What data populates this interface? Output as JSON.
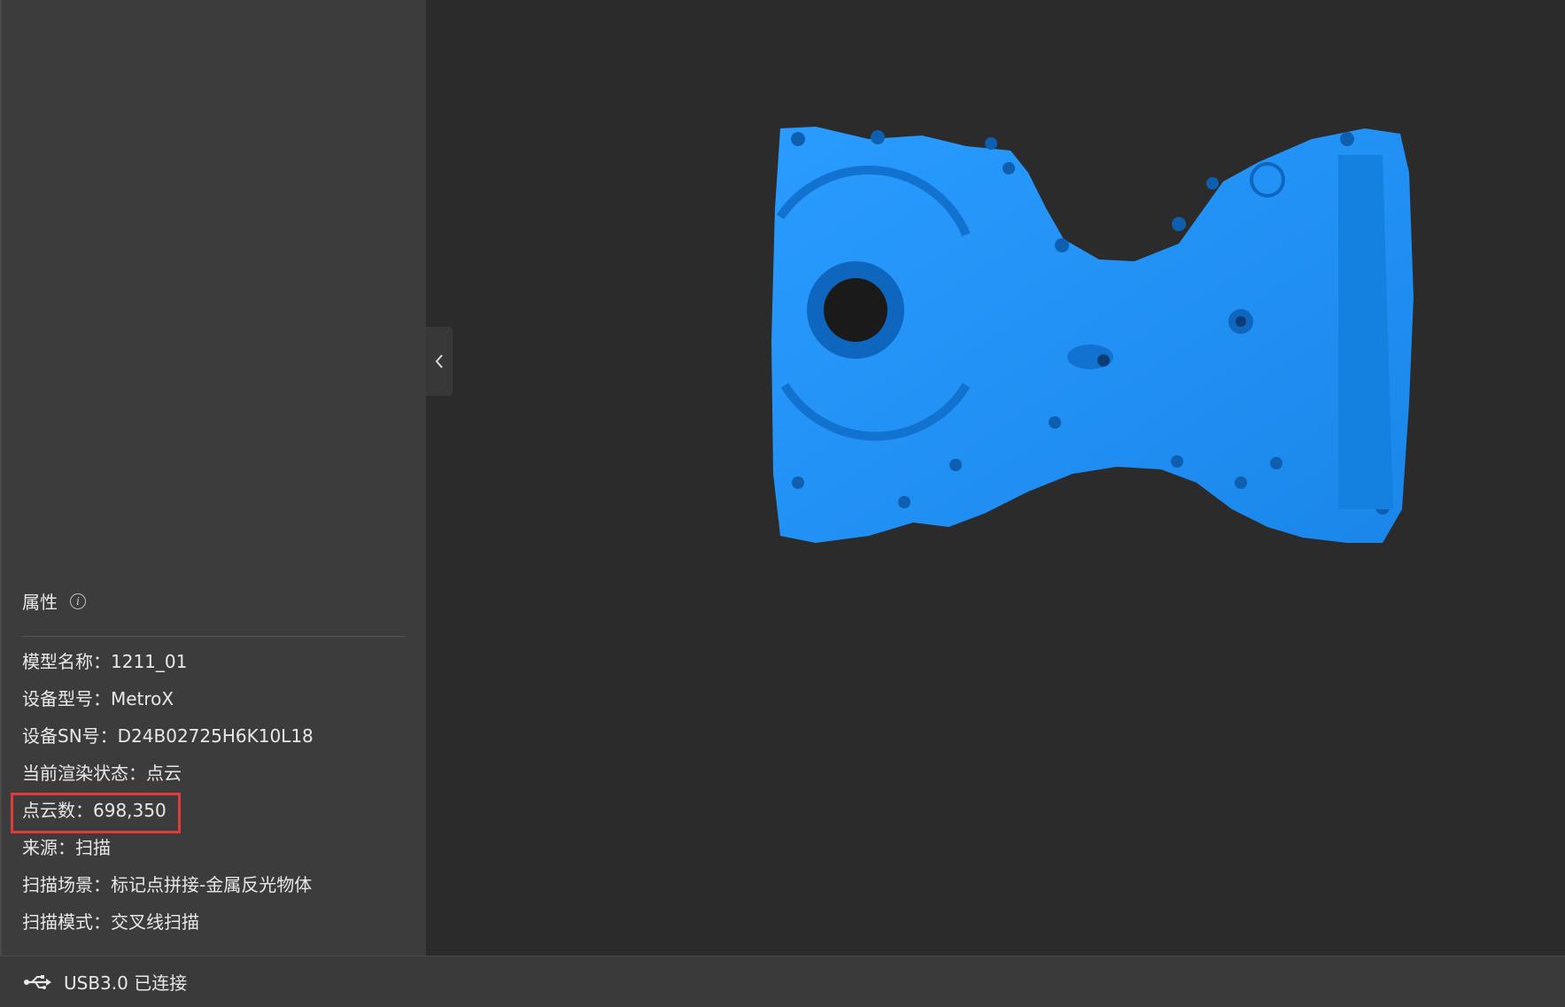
{
  "properties": {
    "header": "属性",
    "info_icon": "info-icon",
    "rows": [
      {
        "label": "模型名称：",
        "value": "1211_01"
      },
      {
        "label": "设备型号：",
        "value": "MetroX"
      },
      {
        "label": "设备SN号：",
        "value": "D24B02725H6K10L18"
      },
      {
        "label": "当前渲染状态：",
        "value": "点云"
      },
      {
        "label": "点云数：",
        "value": "698,350"
      },
      {
        "label": "来源：",
        "value": "扫描"
      },
      {
        "label": "扫描场景：",
        "value": "标记点拼接-金属反光物体"
      },
      {
        "label": "扫描模式：",
        "value": "交叉线扫描"
      }
    ],
    "highlight_color": "#e03a3a"
  },
  "viewport": {
    "model_color": "#1e90ff",
    "background": "#2b2b2b"
  },
  "collapse_icon": "chevron-left-icon",
  "status_bar": {
    "icon": "usb-icon",
    "text": "USB3.0 已连接"
  }
}
